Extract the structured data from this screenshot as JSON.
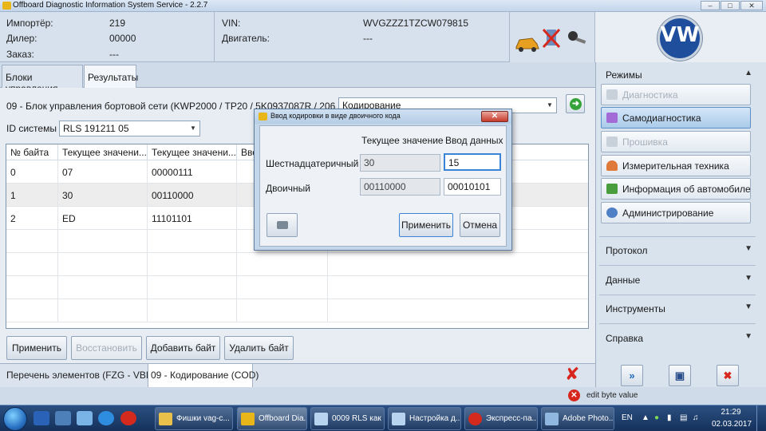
{
  "window": {
    "title": "Offboard Diagnostic Information System Service - 2.2.7"
  },
  "info": {
    "importer_label": "Импортёр:",
    "importer_value": "219",
    "dealer_label": "Дилер:",
    "dealer_value": "00000",
    "order_label": "Заказ:",
    "order_value": "---",
    "vin_label": "VIN:",
    "vin_value": "WVGZZZ1TZCW079815",
    "engine_label": "Двигатель:",
    "engine_value": "---"
  },
  "tabs": [
    {
      "label": "Блоки управления"
    },
    {
      "label": "Результаты"
    }
  ],
  "main": {
    "control_unit": "09 - Блок управления бортовой сети  (KWP2000 / TP20 / 5K0937087R  / 2068 /",
    "function_select": "Кодирование",
    "system_id_label": "ID системы",
    "system_id_value": "RLS 191211 05"
  },
  "grid": {
    "columns": [
      "№ байта",
      "Текущее значени...",
      "Текущее значени...",
      "Ввод"
    ],
    "rows": [
      {
        "byte": "0",
        "hex": "07",
        "bin": "00000111"
      },
      {
        "byte": "1",
        "hex": "30",
        "bin": "00110000"
      },
      {
        "byte": "2",
        "hex": "ED",
        "bin": "11101101"
      }
    ]
  },
  "actions": {
    "apply": "Применить",
    "restore": "Восстановить",
    "add_byte": "Добавить байт",
    "delete_byte": "Удалить байт"
  },
  "status": {
    "element_list": "Перечень элементов (FZG - VBL)",
    "current": "09 - Кодирование (COD)",
    "message": "edit byte value"
  },
  "right_panel": {
    "modes_label": "Режимы",
    "modes": [
      {
        "label": "Диагностика",
        "state": "disabled"
      },
      {
        "label": "Самодиагностика",
        "state": "selected"
      },
      {
        "label": "Прошивка",
        "state": "disabled"
      },
      {
        "label": "Измерительная техника",
        "state": "normal"
      },
      {
        "label": "Информация об автомобиле",
        "state": "normal"
      },
      {
        "label": "Администрирование",
        "state": "normal"
      }
    ],
    "sections": [
      "Протокол",
      "Данные",
      "Инструменты",
      "Справка"
    ]
  },
  "dialog": {
    "title": "Ввод кодировки в виде двоичного кода",
    "col_current": "Текущее значение",
    "col_input": "Ввод данных",
    "hex_label": "Шестнадцатеричный",
    "hex_current": "30",
    "hex_input": "15",
    "bin_label": "Двоичный",
    "bin_current": "00110000",
    "bin_input": "00010101",
    "apply": "Применить",
    "cancel": "Отмена"
  },
  "taskbar": {
    "items": [
      {
        "label": "Фишки vag-c..."
      },
      {
        "label": "Offboard Dia..."
      },
      {
        "label": "0009 RLS как ..."
      },
      {
        "label": "Настройка д..."
      },
      {
        "label": "Экспресс-па..."
      },
      {
        "label": "Adobe Photo..."
      }
    ],
    "lang": "EN",
    "time": "21:29",
    "date": "02.03.2017"
  },
  "colors": {
    "accent": "#3a84d6",
    "error": "#d7261b",
    "brand": "#1f4f9c"
  }
}
